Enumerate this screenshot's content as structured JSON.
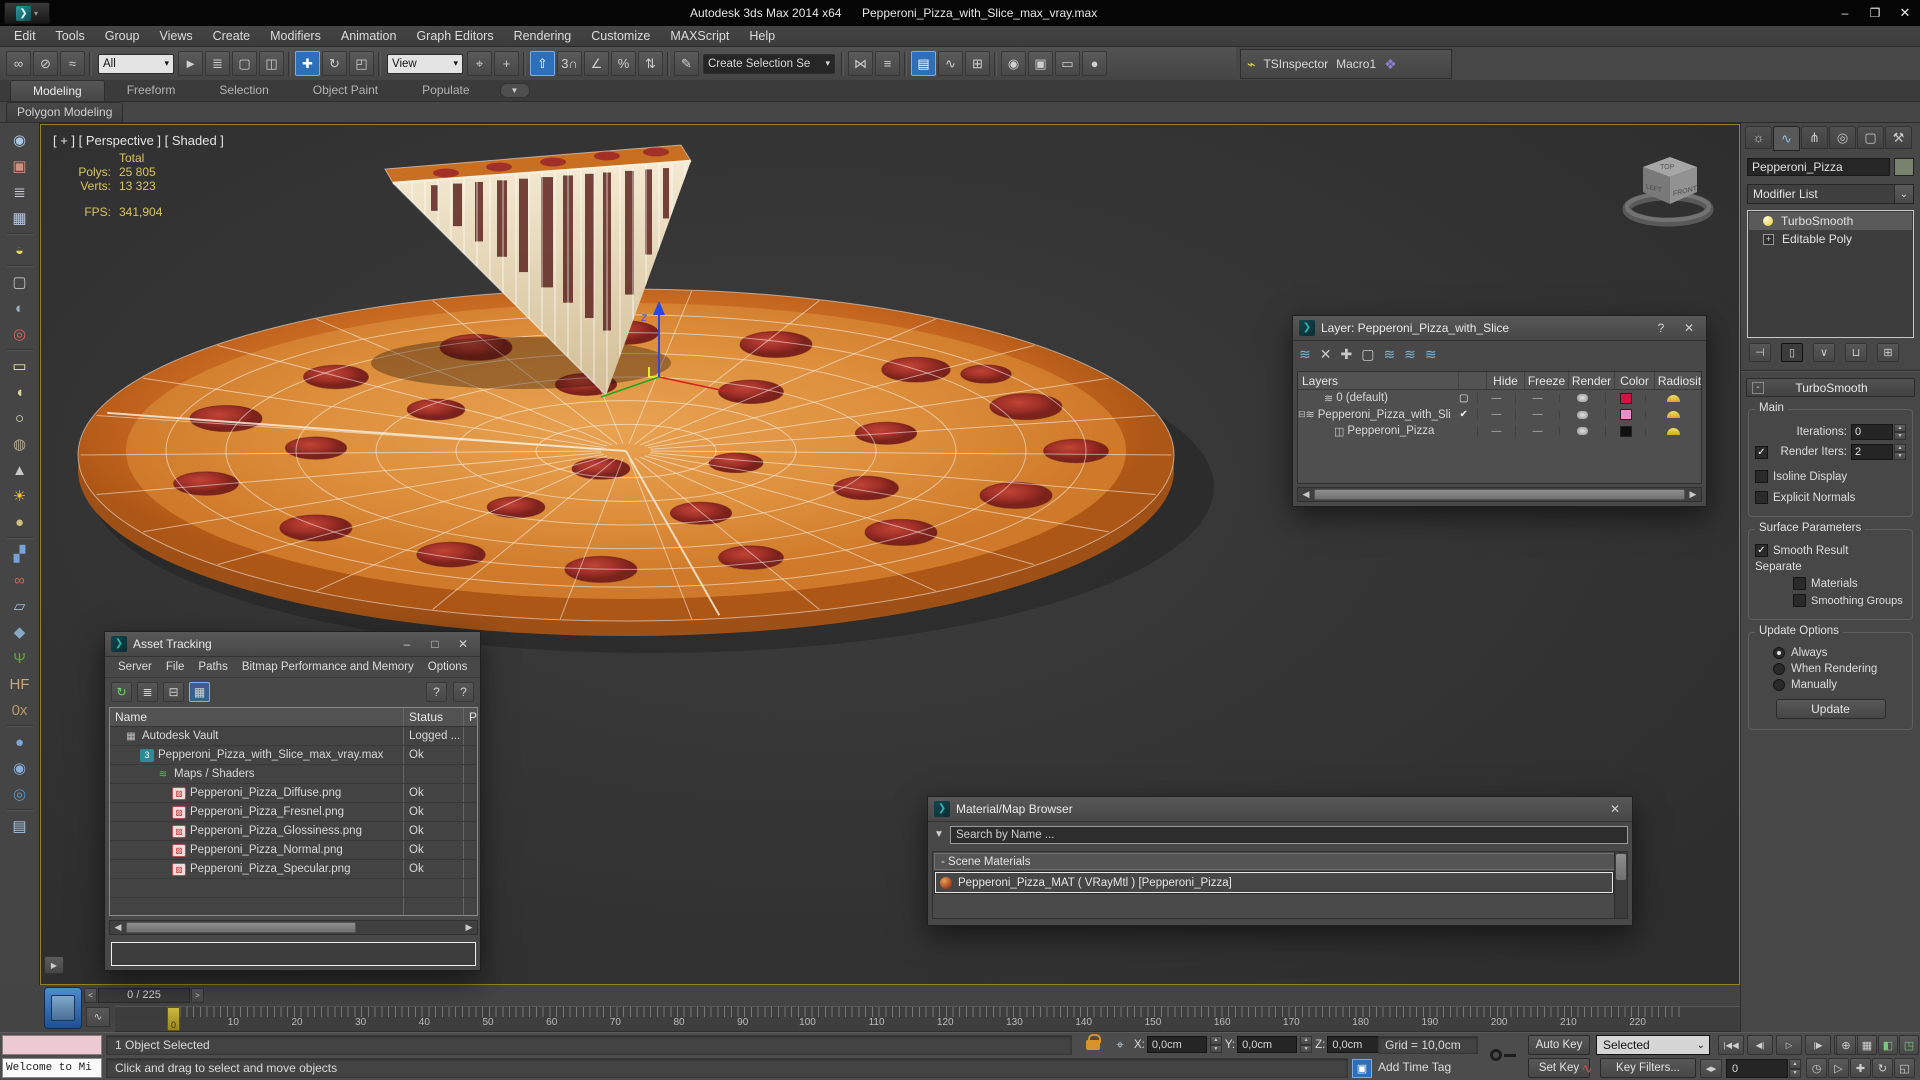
{
  "titlebar": {
    "app_title": "Autodesk 3ds Max 2014 x64",
    "file_title": "Pepperoni_Pizza_with_Slice_max_vray.max",
    "logo_glyph": "❯",
    "minimize": "–",
    "maximize": "❐",
    "close": "✕"
  },
  "menus": [
    "Edit",
    "Tools",
    "Group",
    "Views",
    "Create",
    "Modifiers",
    "Animation",
    "Graph Editors",
    "Rendering",
    "Customize",
    "MAXScript",
    "Help"
  ],
  "toolbar": {
    "items": [
      {
        "label": "∞",
        "cls": "tbtn",
        "name": "link-icon"
      },
      {
        "label": "⊘",
        "cls": "tbtn",
        "name": "unlink-icon"
      },
      {
        "label": "≈",
        "cls": "tbtn",
        "name": "bind-to-spacewarp-icon"
      },
      {
        "label": "",
        "cls": "sep",
        "name": "separator"
      },
      {
        "label": "All",
        "cls": "combo light w74",
        "name": "selection-filter-dropdown"
      },
      {
        "label": "►",
        "cls": "tbtn",
        "name": "select-object-icon"
      },
      {
        "label": "≣",
        "cls": "tbtn",
        "name": "select-by-name-icon"
      },
      {
        "label": "▢",
        "cls": "tbtn",
        "name": "rectangular-selection-icon"
      },
      {
        "label": "◫",
        "cls": "tbtn",
        "name": "window-crossing-icon"
      },
      {
        "label": "",
        "cls": "sep",
        "name": "separator"
      },
      {
        "label": "✚",
        "cls": "tbtn active",
        "name": "select-move-icon"
      },
      {
        "label": "↻",
        "cls": "tbtn",
        "name": "select-rotate-icon"
      },
      {
        "label": "◰",
        "cls": "tbtn",
        "name": "select-scale-icon"
      },
      {
        "label": "",
        "cls": "sep",
        "name": "separator"
      },
      {
        "label": "View",
        "cls": "combo light w74",
        "name": "reference-coordsys-dropdown"
      },
      {
        "label": "⌖",
        "cls": "tbtn",
        "name": "use-pivot-center-icon"
      },
      {
        "label": "+",
        "cls": "tbtn",
        "name": "select-manipulate-icon"
      },
      {
        "label": "",
        "cls": "sep",
        "name": "separator"
      },
      {
        "label": "⇧",
        "cls": "tbtn active",
        "name": "keyboard-override-icon"
      },
      {
        "label": "3∩",
        "cls": "tbtn",
        "name": "snap-3d-icon"
      },
      {
        "label": "∠",
        "cls": "tbtn",
        "name": "angle-snap-icon"
      },
      {
        "label": "%",
        "cls": "tbtn",
        "name": "percent-snap-icon"
      },
      {
        "label": "⇅",
        "cls": "tbtn",
        "name": "spinner-snap-icon"
      },
      {
        "label": "",
        "cls": "sep",
        "name": "separator"
      },
      {
        "label": "✎",
        "cls": "tbtn",
        "name": "named-selection-sets-icon"
      },
      {
        "label": "Create Selection Se",
        "cls": "combo dark w150",
        "name": "named-selection-set-dropdown"
      },
      {
        "label": "",
        "cls": "sep",
        "name": "separator"
      },
      {
        "label": "⋈",
        "cls": "tbtn",
        "name": "mirror-icon"
      },
      {
        "label": "≡",
        "cls": "tbtn",
        "name": "align-icon"
      },
      {
        "label": "",
        "cls": "sep",
        "name": "separator"
      },
      {
        "label": "▤",
        "cls": "tbtn active",
        "name": "layer-manager-icon"
      },
      {
        "label": "∿",
        "cls": "tbtn",
        "name": "curve-editor-icon"
      },
      {
        "label": "⊞",
        "cls": "tbtn",
        "name": "schematic-view-icon"
      },
      {
        "label": "",
        "cls": "sep",
        "name": "separator"
      },
      {
        "label": "◉",
        "cls": "tbtn",
        "name": "material-editor-icon"
      },
      {
        "label": "▣",
        "cls": "tbtn",
        "name": "render-setup-icon"
      },
      {
        "label": "▭",
        "cls": "tbtn",
        "name": "rendered-frame-icon"
      },
      {
        "label": "●",
        "cls": "tbtn",
        "name": "render-production-icon"
      }
    ],
    "flash_glyph": "⌁",
    "tsinspector": "TSInspector",
    "macro": "Macro1",
    "macro_grid_glyph": "❖"
  },
  "ribbon": {
    "tabs": [
      {
        "label": "Modeling",
        "cls": "active",
        "name": "tab-modeling"
      },
      {
        "label": "Freeform",
        "cls": "",
        "name": "tab-freeform"
      },
      {
        "label": "Selection",
        "cls": "",
        "name": "tab-selection"
      },
      {
        "label": "Object Paint",
        "cls": "",
        "name": "tab-object-paint"
      },
      {
        "label": "Populate",
        "cls": "",
        "name": "tab-populate"
      }
    ],
    "dd_glyph": "▼",
    "subtab": "Polygon Modeling"
  },
  "left_strip": {
    "icons": [
      {
        "g": "◉",
        "name": "render-teapot-icon",
        "color": "#aac8e4",
        "cls": ""
      },
      {
        "g": "▣",
        "name": "rendered-frame-window-icon",
        "color": "#d09080",
        "cls": ""
      },
      {
        "g": "≣",
        "name": "render-dialog-icon",
        "color": "#ccccdd",
        "cls": ""
      },
      {
        "g": "▦",
        "name": "render-settings-icon",
        "color": "#b8c8e0",
        "cls": ""
      },
      {
        "g": "",
        "name": "strip-separator",
        "color": "",
        "cls": "ssep"
      },
      {
        "g": "◒",
        "name": "light-lister-icon",
        "color": "#e8d858",
        "cls": ""
      },
      {
        "g": "",
        "name": "strip-separator",
        "color": "",
        "cls": "ssep"
      },
      {
        "g": "▢",
        "name": "camera-bw-icon",
        "color": "#c0c0c0",
        "cls": ""
      },
      {
        "g": "◐",
        "name": "camera-night-icon",
        "color": "#9ab0c0",
        "cls": ""
      },
      {
        "g": "◎",
        "name": "camera-red-icon",
        "color": "#d86860",
        "cls": ""
      },
      {
        "g": "",
        "name": "strip-separator",
        "color": "",
        "cls": "ssep"
      },
      {
        "g": "▭",
        "name": "area-light-icon",
        "color": "#eee8a8",
        "cls": ""
      },
      {
        "g": "◖",
        "name": "dome-light-icon",
        "color": "#ded8a0",
        "cls": ""
      },
      {
        "g": "○",
        "name": "sphere-light-icon",
        "color": "#e8e8c8",
        "cls": ""
      },
      {
        "g": "◍",
        "name": "wire-teapot-icon",
        "color": "#b0a890",
        "cls": ""
      },
      {
        "g": "▲",
        "name": "cone-light-icon",
        "color": "#c8c8c8",
        "cls": ""
      },
      {
        "g": "☀",
        "name": "sun-icon",
        "color": "#f0c030",
        "cls": ""
      },
      {
        "g": "●",
        "name": "sky-sphere-icon",
        "color": "#cfc080",
        "cls": ""
      },
      {
        "g": "",
        "name": "strip-separator",
        "color": "",
        "cls": "ssep"
      },
      {
        "g": "▞",
        "name": "array-icon",
        "color": "#7aa0d8",
        "cls": ""
      },
      {
        "g": "∞",
        "name": "spheres-icon",
        "color": "#c86858",
        "cls": ""
      },
      {
        "g": "▱",
        "name": "plane-icon",
        "color": "#a8c0d8",
        "cls": ""
      },
      {
        "g": "◆",
        "name": "rock-icon",
        "color": "#88a8c8",
        "cls": ""
      },
      {
        "g": "Ψ",
        "name": "grass-icon",
        "color": "#58a838",
        "cls": ""
      },
      {
        "g": "HF",
        "name": "hair-fur-icon",
        "color": "#c8a878",
        "cls": "txt"
      },
      {
        "g": "0x",
        "name": "fur-ox-icon",
        "color": "#b89868",
        "cls": "txt"
      },
      {
        "g": "",
        "name": "strip-separator",
        "color": "",
        "cls": "ssep"
      },
      {
        "g": "●",
        "name": "sphere-blue-icon",
        "color": "#78a8d8",
        "cls": ""
      },
      {
        "g": "◉",
        "name": "sphere-pick-icon",
        "color": "#88b0d8",
        "cls": ""
      },
      {
        "g": "◎",
        "name": "sphere-select-icon",
        "color": "#5898d0",
        "cls": ""
      },
      {
        "g": "",
        "name": "strip-separator",
        "color": "",
        "cls": "ssep"
      },
      {
        "g": "▤",
        "name": "doc-icon",
        "color": "#a8c0e0",
        "cls": ""
      }
    ],
    "overflow_arrow": "▶"
  },
  "viewport": {
    "label": "[ + ] [ Perspective ] [ Shaded ]",
    "stats": {
      "total_label": "Total",
      "polys_label": "Polys:",
      "polys": "25 805",
      "verts_label": "Verts:",
      "verts": "13 323",
      "fps_label": "FPS:",
      "fps": "341,904"
    },
    "axis_label": "z",
    "viewcube": {
      "top": "TOP",
      "left": "LEFT",
      "front": "FRONT"
    }
  },
  "layer_dialog": {
    "title": "Layer: Pepperoni_Pizza_with_Slice",
    "help": "?",
    "close": "✕",
    "dash": "—",
    "toolbar": [
      {
        "g": "≋",
        "name": "new-layer-icon",
        "cls": ""
      },
      {
        "g": "✕",
        "name": "delete-layer-icon",
        "cls": "gray"
      },
      {
        "g": "✚",
        "name": "add-to-layer-icon",
        "cls": "gray"
      },
      {
        "g": "▢",
        "name": "select-highlighted-icon",
        "cls": "gray"
      },
      {
        "g": "≋",
        "name": "select-layer-objects-icon",
        "cls": ""
      },
      {
        "g": "≋",
        "name": "highlight-layer-icon",
        "cls": ""
      },
      {
        "g": "≋",
        "name": "layer-properties-icon",
        "cls": ""
      }
    ],
    "cols": {
      "layers": "Layers",
      "hide": "Hide",
      "freeze": "Freeze",
      "render": "Render",
      "color": "Color",
      "radiosity": "Radiosity"
    },
    "rows": [
      {
        "expand": "",
        "icon_glyph": "≋",
        "name": "0 (default)",
        "indent": 14,
        "current": "▢",
        "color": "#cc1745"
      },
      {
        "expand": "⊟",
        "icon_glyph": "≋",
        "name": "Pepperoni_Pizza_with_Slice",
        "indent": 0,
        "current": "✔",
        "color": "#f08ac8"
      },
      {
        "expand": "",
        "icon_glyph": "◫",
        "name": "Pepperoni_Pizza",
        "indent": 24,
        "current": "",
        "color": "#101010"
      }
    ],
    "hscroll_left": "◀",
    "hscroll_right": "▶"
  },
  "asset_dialog": {
    "title": "Asset Tracking",
    "minimize": "–",
    "maximize": "□",
    "close": "✕",
    "menus": [
      "Server",
      "File",
      "Paths",
      "Bitmap Performance and Memory",
      "Options"
    ],
    "toolbar": [
      {
        "g": "↻",
        "name": "refresh-icon",
        "cls": "green"
      },
      {
        "g": "≣",
        "name": "info-view-icon",
        "cls": ""
      },
      {
        "g": "⊟",
        "name": "tree-view-icon",
        "cls": ""
      },
      {
        "g": "▦",
        "name": "table-view-icon",
        "cls": "active"
      }
    ],
    "help_icons": [
      {
        "g": "?",
        "name": "help-mode-icon"
      },
      {
        "g": "?",
        "name": "help-icon"
      }
    ],
    "cols": {
      "name": "Name",
      "status": "Status",
      "p": "P"
    },
    "rows": [
      {
        "icon": "ic-vault",
        "g": "▦",
        "name": "Autodesk Vault",
        "status": "Logged ...",
        "indent": 14
      },
      {
        "icon": "ic-max",
        "g": "3",
        "name": "Pepperoni_Pizza_with_Slice_max_vray.max",
        "status": "Ok",
        "indent": 30
      },
      {
        "icon": "ic-map",
        "g": "≋",
        "name": "Maps / Shaders",
        "status": "",
        "indent": 46
      },
      {
        "icon": "ic-bmp",
        "g": "▨",
        "name": "Pepperoni_Pizza_Diffuse.png",
        "status": "Ok",
        "indent": 62
      },
      {
        "icon": "ic-bmp",
        "g": "▨",
        "name": "Pepperoni_Pizza_Fresnel.png",
        "status": "Ok",
        "indent": 62
      },
      {
        "icon": "ic-bmp",
        "g": "▨",
        "name": "Pepperoni_Pizza_Glossiness.png",
        "status": "Ok",
        "indent": 62
      },
      {
        "icon": "ic-bmp",
        "g": "▨",
        "name": "Pepperoni_Pizza_Normal.png",
        "status": "Ok",
        "indent": 62
      },
      {
        "icon": "ic-bmp",
        "g": "▨",
        "name": "Pepperoni_Pizza_Specular.png",
        "status": "Ok",
        "indent": 62
      },
      {
        "icon": "ic-none",
        "g": "",
        "name": "",
        "status": "",
        "indent": 0
      },
      {
        "icon": "ic-none",
        "g": "",
        "name": "",
        "status": "",
        "indent": 0
      }
    ],
    "hscroll_left": "◀",
    "hscroll_right": "▶"
  },
  "material_dialog": {
    "title": "Material/Map Browser",
    "close": "✕",
    "funnel": "▼",
    "search_placeholder": "Search by Name ...",
    "group": "- Scene Materials",
    "item": "Pepperoni_Pizza_MAT ( VRayMtl ) [Pepperoni_Pizza]"
  },
  "command_panel": {
    "tabs": [
      {
        "g": "☼",
        "name": "create-tab",
        "cls": ""
      },
      {
        "g": "∿",
        "name": "modify-tab",
        "cls": "active"
      },
      {
        "g": "⋔",
        "name": "hierarchy-tab",
        "cls": ""
      },
      {
        "g": "◎",
        "name": "motion-tab",
        "cls": ""
      },
      {
        "g": "▢",
        "name": "display-tab",
        "cls": ""
      },
      {
        "g": "⚒",
        "name": "utilities-tab",
        "cls": ""
      }
    ],
    "object_name": "Pepperoni_Pizza",
    "modifier_list_label": "Modifier List",
    "stack": [
      {
        "label": "TurboSmooth",
        "cls": "sel",
        "ico": "bulb",
        "ig": ""
      },
      {
        "label": "Editable Poly",
        "cls": "",
        "ico": "plus",
        "ig": "+"
      }
    ],
    "stack_buttons": [
      {
        "g": "⊣",
        "name": "pin-stack-button",
        "cls": ""
      },
      {
        "g": "▯",
        "name": "show-end-result-button",
        "cls": "pressed"
      },
      {
        "g": "∨",
        "name": "make-unique-button",
        "cls": ""
      },
      {
        "g": "⊔",
        "name": "remove-modifier-button",
        "cls": ""
      },
      {
        "g": "⊞",
        "name": "configure-modifier-sets-button",
        "cls": ""
      }
    ],
    "rollout": {
      "collapse": "-",
      "title": "TurboSmooth",
      "main_group": "Main",
      "iterations_label": "Iterations:",
      "iterations": "0",
      "render_iters_label": "Render Iters:",
      "render_iters": "2",
      "check": "✓",
      "isoline": "Isoline Display",
      "explicit": "Explicit Normals",
      "surface_group": "Surface Parameters",
      "smooth_result": "Smooth Result",
      "separate": "Separate",
      "materials": "Materials",
      "smoothing_groups": "Smoothing Groups",
      "update_group": "Update Options",
      "always": "Always",
      "when_rendering": "When Rendering",
      "manually": "Manually",
      "update_button": "Update"
    }
  },
  "timeline": {
    "range": "0 / 225",
    "range_left": "<",
    "range_right": ">",
    "curve_mini_glyph": "∿",
    "labels": [
      "0",
      "10",
      "20",
      "30",
      "40",
      "50",
      "60",
      "70",
      "80",
      "90",
      "100",
      "110",
      "120",
      "130",
      "140",
      "150",
      "160",
      "170",
      "180",
      "190",
      "200",
      "210",
      "220"
    ],
    "slider_value": "0"
  },
  "statusbar": {
    "listener_text": "Welcome to Mi",
    "selected_info": "1 Object Selected",
    "prompt": "Click and drag to select and move objects",
    "gizmo_glyph": "⌖",
    "coords": [
      {
        "label": "X:",
        "value": "0,0cm",
        "name": "x-coordinate-field"
      },
      {
        "label": "Y:",
        "value": "0,0cm",
        "name": "y-coordinate-field"
      },
      {
        "label": "Z:",
        "value": "0,0cm",
        "name": "z-coordinate-field"
      }
    ],
    "grid": "Grid = 10,0cm",
    "add_time_tag": "Add Time Tag",
    "addtag_glyph": "▣",
    "auto_key": "Auto Key",
    "set_key": "Set Key",
    "selected_filter": "Selected",
    "key_filters": "Key Filters...",
    "curve_glyph": "∿",
    "keymode_glyph": "◀▶",
    "frame": "0",
    "playback": [
      {
        "g": "|◀◀",
        "name": "go-to-start-button"
      },
      {
        "g": "◀|",
        "name": "previous-frame-button"
      },
      {
        "g": "▷",
        "name": "play-button"
      },
      {
        "g": "|▶",
        "name": "next-frame-button"
      },
      {
        "g": "▶▶|",
        "name": "go-to-end-button"
      }
    ],
    "vp_icons": [
      {
        "g": "⊕",
        "name": "zoom-extents-icon",
        "cls": ""
      },
      {
        "g": "▦",
        "name": "viewport-layout-icon",
        "cls": ""
      },
      {
        "g": "◧",
        "name": "zoom-extents-selected-icon",
        "cls": "grn"
      },
      {
        "g": "◳",
        "name": "zoom-extents-all-icon",
        "cls": "grn"
      }
    ],
    "nav_icons": [
      {
        "g": "◷",
        "name": "time-configuration-icon"
      },
      {
        "g": "▷",
        "name": "play-selected-icon"
      },
      {
        "g": "✚",
        "name": "pan-hand-icon"
      },
      {
        "g": "↻",
        "name": "orbit-icon"
      },
      {
        "g": "◱",
        "name": "maximize-viewport-icon"
      }
    ]
  }
}
